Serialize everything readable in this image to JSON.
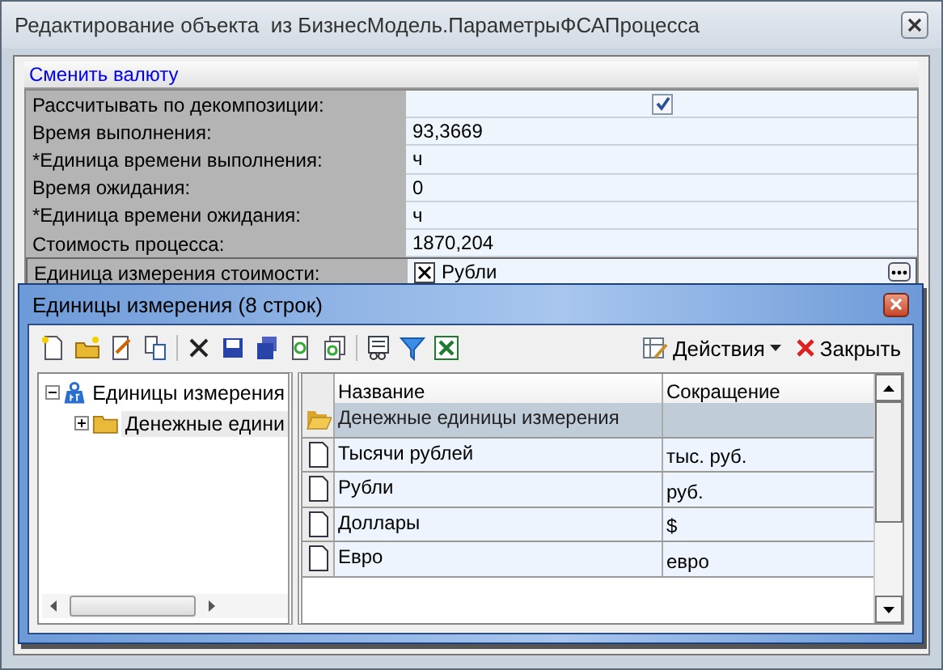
{
  "window": {
    "title": "Редактирование объекта  из БизнесМодель.ПараметрыФСАПроцесса"
  },
  "link": "Сменить валюту",
  "properties": [
    {
      "kind": "checkbox",
      "label": "Рассчитывать по декомпозиции:",
      "checked": true
    },
    {
      "kind": "text",
      "label": "Время выполнения:",
      "value": "93,3669"
    },
    {
      "kind": "text",
      "label": "*Единица времени выполнения:",
      "value": "ч"
    },
    {
      "kind": "text",
      "label": "Время ожидания:",
      "value": "0"
    },
    {
      "kind": "text",
      "label": "*Единица времени ожидания:",
      "value": "ч"
    },
    {
      "kind": "text",
      "label": "Стоимость процесса:",
      "value": "1870,204"
    },
    {
      "kind": "picker",
      "label": "Единица измерения стоимости:",
      "value": "Рубли"
    }
  ],
  "dialog": {
    "title": "Единицы измерения (8 строк)",
    "actions": "Действия",
    "close": "Закрыть",
    "tree": {
      "label": "Единицы измерения",
      "expanded": true,
      "children": [
        {
          "label": "Денежные едини",
          "expanded": false,
          "selected": true
        }
      ]
    },
    "table": {
      "columns": [
        "Название",
        "Сокращение"
      ],
      "rows": [
        {
          "kind": "folder",
          "name": "Денежные единицы измерения",
          "selected": true
        },
        {
          "kind": "item",
          "name": "Тысячи рублей",
          "abbr": "тыс. руб.",
          "selected": false
        },
        {
          "kind": "item",
          "name": "Рубли",
          "abbr": "руб.",
          "selected": false
        },
        {
          "kind": "item",
          "name": "Доллары",
          "abbr": "$",
          "selected": false
        },
        {
          "kind": "item",
          "name": "Евро",
          "abbr": "евро",
          "selected": false
        }
      ]
    }
  }
}
